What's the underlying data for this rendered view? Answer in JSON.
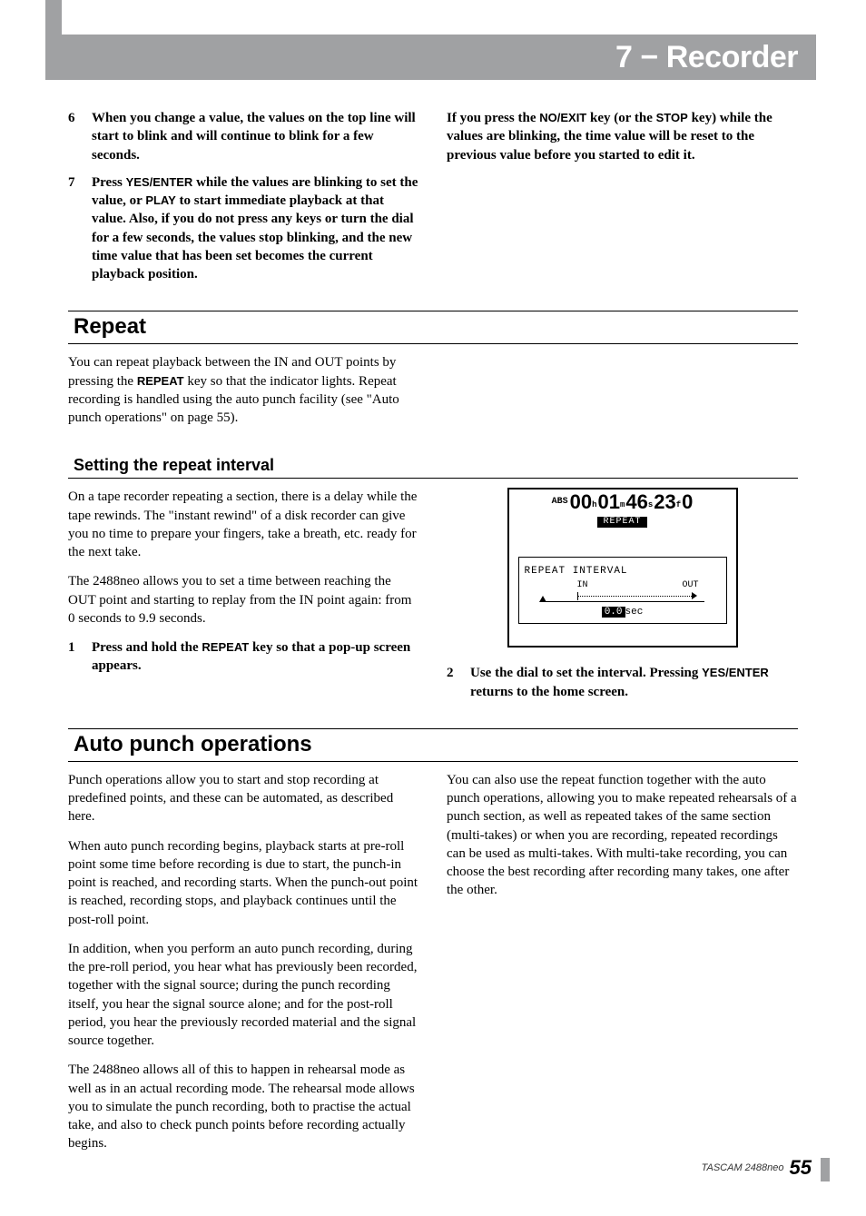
{
  "header": {
    "title": "7 − Recorder"
  },
  "intro_left": [
    {
      "num": "6",
      "bold": true,
      "text": "When you change a value, the values on the top line will start to blink and will continue to blink for a few seconds."
    },
    {
      "num": "7",
      "bold": true,
      "text_parts": [
        "Press ",
        "YES/ENTER",
        " while the values are blinking to set the value, or ",
        "PLAY",
        " to start immediate playback at that value. Also, if you do not press any keys or turn the dial for a few seconds, the values stop blinking, and the new time value that has been set becomes the current playback position."
      ]
    }
  ],
  "intro_right_parts": [
    "If you press the ",
    "NO/EXIT",
    " key (or the ",
    "STOP",
    " key) while the values are blinking, the time value will be reset to the previous value before you started to edit it."
  ],
  "repeat": {
    "heading": "Repeat",
    "body_parts": [
      "You can repeat playback between the IN and OUT points by pressing the ",
      "REPEAT",
      " key so that the indicator lights. Repeat recording is handled using the auto punch facility (see \"Auto punch operations\" on page 55)."
    ]
  },
  "interval": {
    "heading": "Setting the repeat interval",
    "p1": "On a tape recorder repeating a section, there is a delay while the tape rewinds. The \"instant rewind\" of a disk recorder can give you no time to prepare your fingers, take a breath, etc. ready for the next take.",
    "p2": "The 2488neo allows you to set a time between reaching the OUT point and starting to replay from the IN point again: from 0 seconds to 9.9 seconds.",
    "step1_parts": [
      "Press and hold the ",
      "REPEAT",
      " key so that a pop-up screen appears."
    ],
    "step2_parts": [
      "Use the dial to set the interval. Pressing ",
      "YES/ENTER",
      " returns to the home screen."
    ]
  },
  "lcd": {
    "abs": "ABS",
    "h": "00",
    "hu": "h",
    "m": "01",
    "mu": "m",
    "s": "46",
    "su": "s",
    "f": "23",
    "fu": "f",
    "sub": "0",
    "repeat_label": "REPEAT",
    "interval_title": "REPEAT INTERVAL",
    "in": "IN",
    "out": "OUT",
    "sec_val": "0.0",
    "sec_unit": "sec"
  },
  "autopunch": {
    "heading": "Auto punch operations",
    "left": [
      "Punch operations allow you to start and stop recording at predefined points, and these can be automated, as described here.",
      "When auto punch recording begins, playback starts at pre-roll point some time before recording is due to start, the punch-in point is reached, and recording starts. When the punch-out point is reached, recording stops, and playback continues until the post-roll point.",
      "In addition, when you perform an auto punch recording, during the pre-roll period, you hear what has previously been recorded, together with the signal source; during the punch recording itself, you hear the signal source alone; and for the post-roll period, you hear the previously recorded material and the signal source together.",
      "The 2488neo allows all of this to happen in rehearsal mode as well as in an actual recording mode. The rehearsal mode allows you to simulate the punch recording, both to practise the actual take, and also to check punch points before recording actually begins."
    ],
    "right": [
      "You can also use the repeat function together with the auto punch operations, allowing you to make repeated rehearsals of a punch section, as well as repeated takes of the same section (multi-takes) or when you are recording, repeated recordings can be used as multi-takes. With multi-take recording, you can choose the best recording after recording many takes, one after the other."
    ]
  },
  "footer": {
    "model": "TASCAM  2488neo",
    "page": "55"
  }
}
